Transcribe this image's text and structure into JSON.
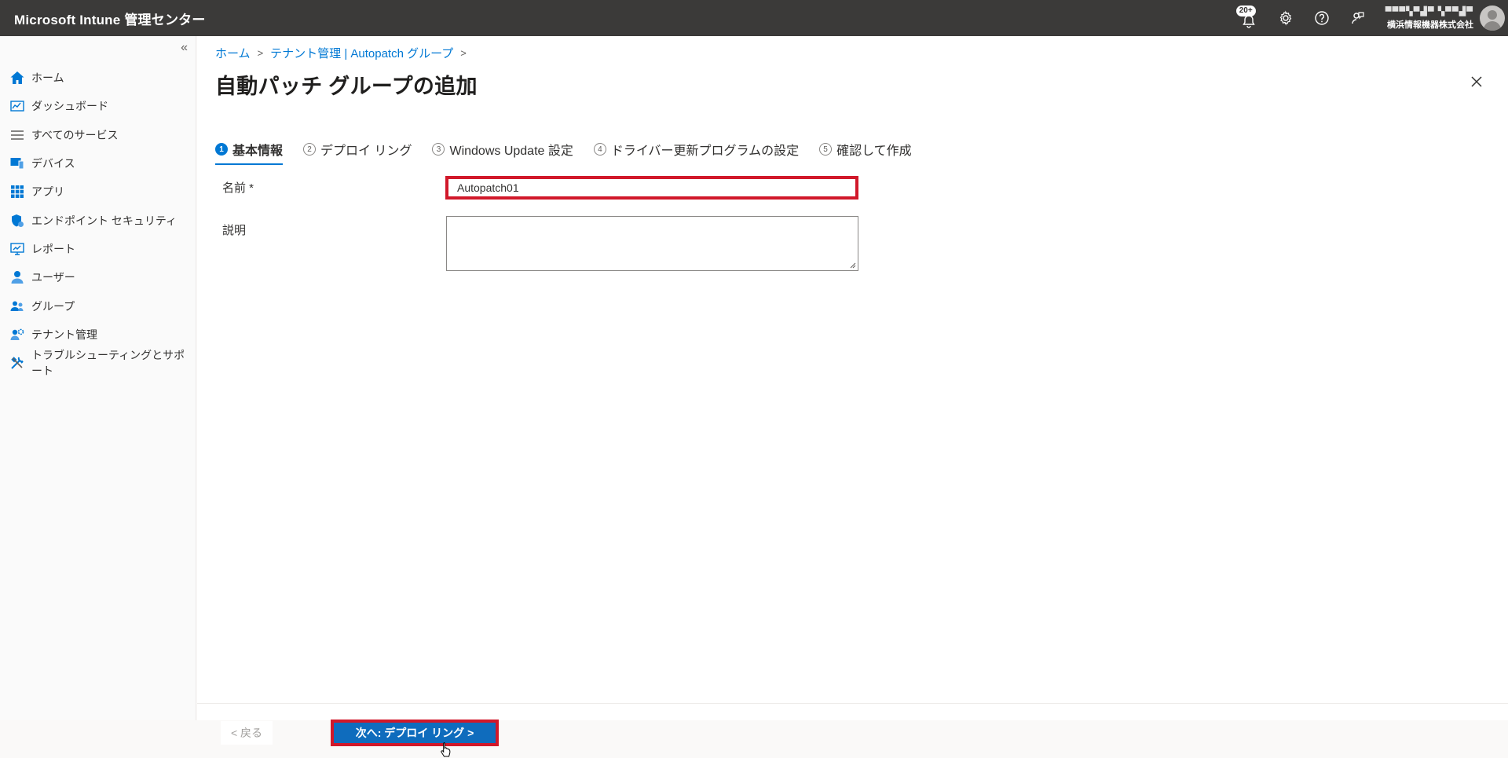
{
  "app": {
    "title": "Microsoft Intune 管理センター"
  },
  "topbar": {
    "notifications_badge": "20+",
    "account_name": "▀▀▀▚▀▟▀ ▚▀▀▟▀",
    "account_org": "横浜情報機器株式会社",
    "icons": [
      "notifications-icon",
      "settings-icon",
      "help-icon",
      "feedback-icon",
      "avatar"
    ]
  },
  "sidebar": {
    "collapse_label": "«",
    "items": [
      {
        "label": "ホーム",
        "icon": "home-icon"
      },
      {
        "label": "ダッシュボード",
        "icon": "dashboard-icon"
      },
      {
        "label": "すべてのサービス",
        "icon": "list-icon"
      },
      {
        "label": "デバイス",
        "icon": "devices-icon"
      },
      {
        "label": "アプリ",
        "icon": "apps-icon"
      },
      {
        "label": "エンドポイント セキュリティ",
        "icon": "shield-icon"
      },
      {
        "label": "レポート",
        "icon": "reports-icon"
      },
      {
        "label": "ユーザー",
        "icon": "user-icon"
      },
      {
        "label": "グループ",
        "icon": "groups-icon"
      },
      {
        "label": "テナント管理",
        "icon": "tenant-icon"
      },
      {
        "label": "トラブルシューティングとサポート",
        "icon": "tools-icon"
      }
    ]
  },
  "breadcrumb": {
    "items": [
      "ホーム",
      "テナント管理 | Autopatch グループ"
    ]
  },
  "page": {
    "title": "自動パッチ グループの追加",
    "more": "···"
  },
  "steps": [
    {
      "num": "1",
      "label": "基本情報",
      "active": true
    },
    {
      "num": "2",
      "label": "デプロイ リング",
      "active": false
    },
    {
      "num": "3",
      "label": "Windows Update 設定",
      "active": false
    },
    {
      "num": "4",
      "label": "ドライバー更新プログラムの設定",
      "active": false
    },
    {
      "num": "5",
      "label": "確認して作成",
      "active": false
    }
  ],
  "form": {
    "name_label": "名前 *",
    "name_value": "Autopatch01",
    "description_label": "説明",
    "description_value": ""
  },
  "footer": {
    "back_label": "< 戻る",
    "next_label": "次へ: デプロイ リング >"
  },
  "colors": {
    "accent": "#0078d4",
    "highlight": "#d1182a",
    "topbar": "#3b3a39"
  }
}
